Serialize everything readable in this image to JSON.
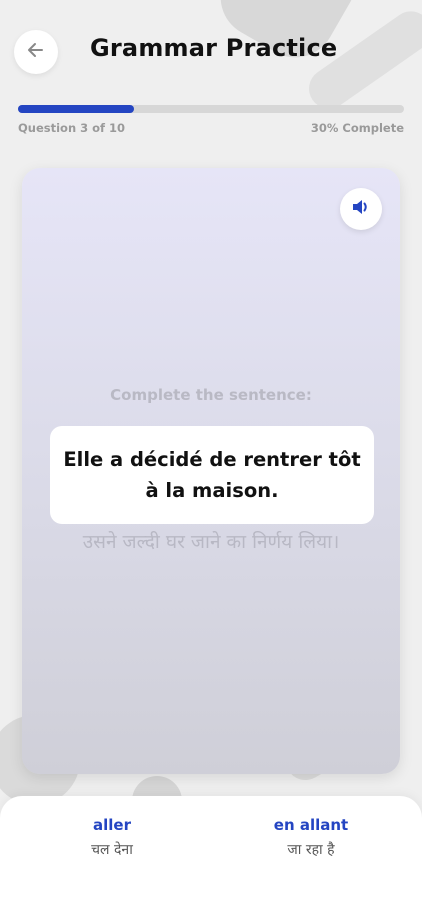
{
  "header": {
    "title": "Grammar Practice",
    "back_icon": "arrow-left-icon"
  },
  "progress": {
    "left_label": "Question 3 of 10",
    "right_label": "30% Complete",
    "percent": 30,
    "color": "#2445c2"
  },
  "card": {
    "audio_icon": "speaker-icon",
    "prompt": "Complete the sentence:",
    "sentence": "Elle a décidé de rentrer tôt à la maison.",
    "translation": "उसने जल्दी घर जाने का निर्णय लिया।"
  },
  "options": [
    {
      "word": "aller",
      "translation": "चल देना"
    },
    {
      "word": "en allant",
      "translation": "जा रहा है"
    }
  ]
}
